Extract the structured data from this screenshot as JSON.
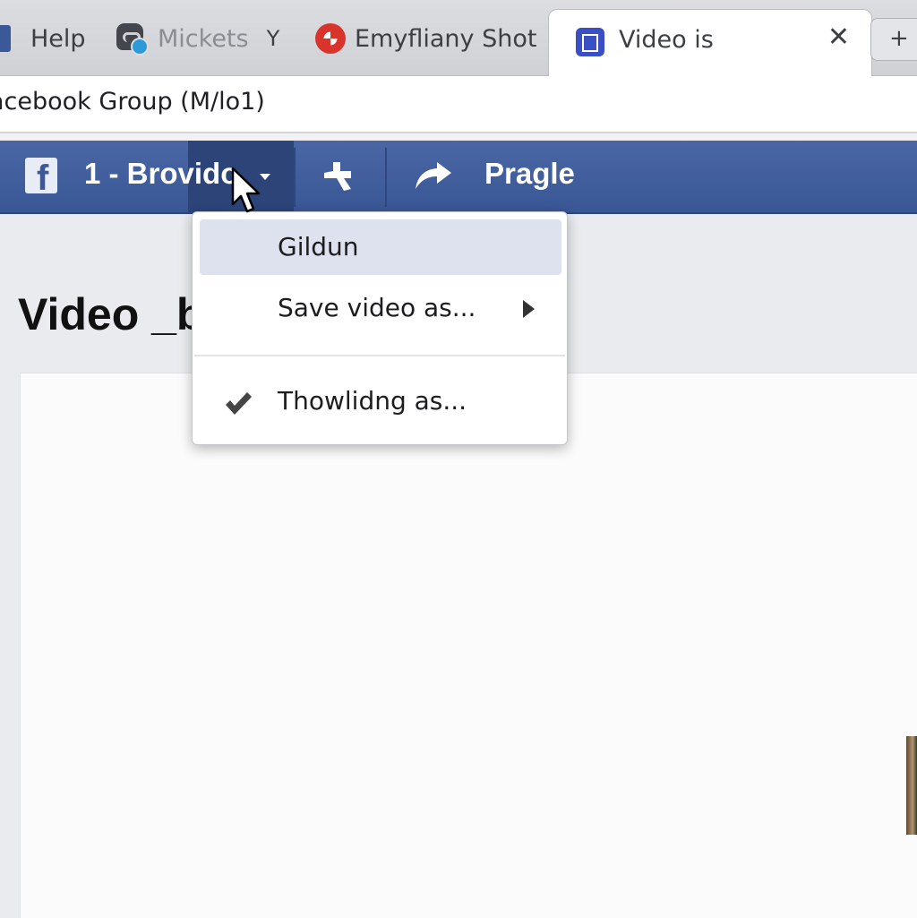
{
  "browser": {
    "tabs": [
      {
        "label": "Help",
        "icon": "page-square-icon",
        "dim": false
      },
      {
        "label": "Mickets",
        "icon": "profile-badge-icon",
        "dim": true,
        "suffix": "Y"
      },
      {
        "label": "Emyfliany Shot",
        "icon": "red-ball-icon",
        "dim": false
      },
      {
        "label": "Video is",
        "icon": "r-square-icon",
        "active": true
      }
    ],
    "close_glyph": "✕",
    "new_tab_glyph": "+",
    "address": "acebook Group (M/lo1)"
  },
  "fb_bar": {
    "logo_glyph": "f",
    "page_label": "1 - Brovido",
    "share_label": "Pragle",
    "colors": {
      "bar": "#3b5998",
      "dropdown_active": "#2c4478"
    }
  },
  "page": {
    "title": "Video _b"
  },
  "context_menu": {
    "items": [
      {
        "label": "Gildun",
        "highlighted": true
      },
      {
        "label": "Save video as...",
        "has_submenu": true
      },
      {
        "label": "Thowlidng as...",
        "checked": true
      }
    ]
  }
}
